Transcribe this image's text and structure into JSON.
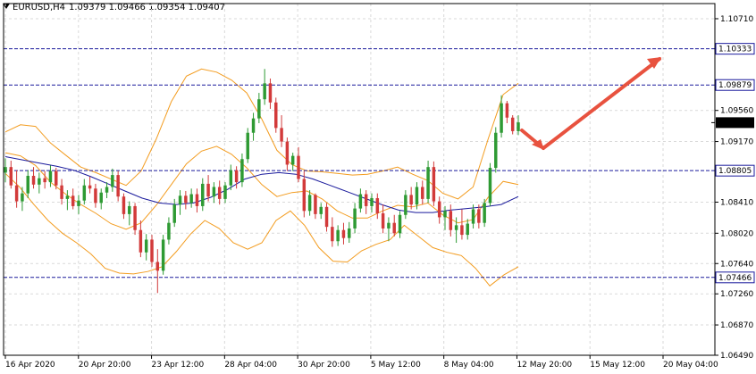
{
  "header": {
    "symbol": "EURUSD,H4",
    "open": "1.09379",
    "high": "1.09466",
    "low": "1.09354",
    "close": "1.09407"
  },
  "colors": {
    "background": "#ffffff",
    "grid": "#d9d9d9",
    "bull_candle": "#2e9a33",
    "bear_candle": "#d23a3a",
    "bollinger": "#f39c1f",
    "moving_average": "#1a1a9c",
    "level_line": "#1a1a9c",
    "arrow": "#e8523f"
  },
  "chart_data": {
    "type": "candlestick",
    "y_ticks": [
      "1.10710",
      "1.09560",
      "1.09170",
      "1.08410",
      "1.08020",
      "1.07640",
      "1.07260",
      "1.06870",
      "1.06490"
    ],
    "x_labels": [
      "16 Apr 2020",
      "20 Apr 20:00",
      "23 Apr 12:00",
      "28 Apr 04:00",
      "30 Apr 20:00",
      "5 May 12:00",
      "8 May 04:00",
      "12 May 20:00",
      "15 May 12:00",
      "20 May 04:00"
    ],
    "ylim": [
      1.0649,
      1.109
    ],
    "grid": true,
    "current_price": "1.09407",
    "horizontal_levels": [
      "1.10333",
      "1.09879",
      "1.08805",
      "1.07466"
    ],
    "candles_ohlc": [
      [
        1.0878,
        1.0896,
        1.0866,
        1.0885
      ],
      [
        1.0885,
        1.0893,
        1.0858,
        1.0862
      ],
      [
        1.0862,
        1.0881,
        1.0834,
        1.0842
      ],
      [
        1.0842,
        1.086,
        1.083,
        1.0852
      ],
      [
        1.0852,
        1.0881,
        1.0846,
        1.0874
      ],
      [
        1.0874,
        1.0885,
        1.0858,
        1.0863
      ],
      [
        1.0863,
        1.0878,
        1.0852,
        1.0871
      ],
      [
        1.0871,
        1.088,
        1.0858,
        1.0866
      ],
      [
        1.0866,
        1.0887,
        1.086,
        1.088
      ],
      [
        1.088,
        1.0884,
        1.0857,
        1.0862
      ],
      [
        1.0862,
        1.087,
        1.0838,
        1.0845
      ],
      [
        1.0845,
        1.0856,
        1.0831,
        1.0849
      ],
      [
        1.0849,
        1.0858,
        1.0832,
        1.0836
      ],
      [
        1.0836,
        1.085,
        1.0826,
        1.0843
      ],
      [
        1.0843,
        1.087,
        1.0838,
        1.0862
      ],
      [
        1.0862,
        1.0873,
        1.0852,
        1.0858
      ],
      [
        1.0858,
        1.0864,
        1.0834,
        1.084
      ],
      [
        1.084,
        1.0858,
        1.0832,
        1.0853
      ],
      [
        1.0853,
        1.0866,
        1.0846,
        1.086
      ],
      [
        1.086,
        1.0883,
        1.0854,
        1.0875
      ],
      [
        1.0875,
        1.088,
        1.0842,
        1.0848
      ],
      [
        1.0848,
        1.0852,
        1.082,
        1.0826
      ],
      [
        1.0826,
        1.0842,
        1.0812,
        1.0836
      ],
      [
        1.0836,
        1.084,
        1.08,
        1.0806
      ],
      [
        1.0806,
        1.0818,
        1.0772,
        1.0778
      ],
      [
        1.0778,
        1.0801,
        1.0768,
        1.0794
      ],
      [
        1.0794,
        1.08,
        1.076,
        1.0766
      ],
      [
        1.0766,
        1.0782,
        1.0727,
        1.0755
      ],
      [
        1.0755,
        1.08,
        1.075,
        1.0794
      ],
      [
        1.0794,
        1.0822,
        1.0788,
        1.0815
      ],
      [
        1.0815,
        1.0845,
        1.081,
        1.0838
      ],
      [
        1.0838,
        1.0856,
        1.0825,
        1.0849
      ],
      [
        1.0849,
        1.0855,
        1.0832,
        1.084
      ],
      [
        1.084,
        1.0858,
        1.0834,
        1.0851
      ],
      [
        1.0851,
        1.0858,
        1.0828,
        1.0836
      ],
      [
        1.0836,
        1.0871,
        1.083,
        1.0864
      ],
      [
        1.0864,
        1.0875,
        1.0842,
        1.0848
      ],
      [
        1.0848,
        1.0866,
        1.084,
        1.086
      ],
      [
        1.086,
        1.0868,
        1.0838,
        1.0845
      ],
      [
        1.0845,
        1.0866,
        1.084,
        1.0862
      ],
      [
        1.0862,
        1.0888,
        1.0856,
        1.0881
      ],
      [
        1.0881,
        1.0886,
        1.0858,
        1.0866
      ],
      [
        1.0866,
        1.0902,
        1.086,
        1.0895
      ],
      [
        1.0895,
        1.0934,
        1.089,
        1.0928
      ],
      [
        1.0928,
        1.0953,
        1.0918,
        1.0946
      ],
      [
        1.0946,
        1.0978,
        1.094,
        1.097
      ],
      [
        1.097,
        1.1008,
        1.0963,
        1.099
      ],
      [
        1.099,
        1.0996,
        1.0958,
        1.0966
      ],
      [
        1.0966,
        1.0972,
        1.0928,
        1.0934
      ],
      [
        1.0934,
        1.095,
        1.091,
        1.0917
      ],
      [
        1.0917,
        1.0922,
        1.088,
        1.0888
      ],
      [
        1.0888,
        1.0903,
        1.088,
        1.0899
      ],
      [
        1.0899,
        1.091,
        1.0866,
        1.087
      ],
      [
        1.087,
        1.088,
        1.0822,
        1.083
      ],
      [
        1.083,
        1.0856,
        1.0824,
        1.085
      ],
      [
        1.085,
        1.0852,
        1.082,
        1.0826
      ],
      [
        1.0826,
        1.084,
        1.082,
        1.0835
      ],
      [
        1.0835,
        1.084,
        1.0804,
        1.081
      ],
      [
        1.081,
        1.0822,
        1.0785,
        1.0792
      ],
      [
        1.0792,
        1.0812,
        1.0786,
        1.0806
      ],
      [
        1.0806,
        1.0815,
        1.0788,
        1.0796
      ],
      [
        1.0796,
        1.0816,
        1.079,
        1.0808
      ],
      [
        1.0808,
        1.084,
        1.0802,
        1.0833
      ],
      [
        1.0833,
        1.0858,
        1.0828,
        1.0851
      ],
      [
        1.0851,
        1.0856,
        1.0826,
        1.0836
      ],
      [
        1.0836,
        1.0852,
        1.0828,
        1.0846
      ],
      [
        1.0846,
        1.0852,
        1.082,
        1.0827
      ],
      [
        1.0827,
        1.0838,
        1.0802,
        1.0808
      ],
      [
        1.0808,
        1.0822,
        1.0792,
        1.0815
      ],
      [
        1.0815,
        1.0825,
        1.0798,
        1.0802
      ],
      [
        1.0802,
        1.083,
        1.0796,
        1.0825
      ],
      [
        1.0825,
        1.0856,
        1.082,
        1.085
      ],
      [
        1.085,
        1.086,
        1.0832,
        1.0838
      ],
      [
        1.0838,
        1.0866,
        1.0832,
        1.086
      ],
      [
        1.086,
        1.0868,
        1.0838,
        1.0845
      ],
      [
        1.0845,
        1.0893,
        1.084,
        1.0885
      ],
      [
        1.0885,
        1.0892,
        1.0836,
        1.0842
      ],
      [
        1.0842,
        1.0848,
        1.0814,
        1.0822
      ],
      [
        1.0822,
        1.0836,
        1.0806,
        1.083
      ],
      [
        1.083,
        1.0838,
        1.0798,
        1.0806
      ],
      [
        1.0806,
        1.0822,
        1.079,
        1.0812
      ],
      [
        1.0812,
        1.0832,
        1.0794,
        1.08
      ],
      [
        1.08,
        1.082,
        1.0794,
        1.0814
      ],
      [
        1.0814,
        1.0838,
        1.0808,
        1.0832
      ],
      [
        1.0832,
        1.0838,
        1.0808,
        1.0815
      ],
      [
        1.0815,
        1.0845,
        1.081,
        1.084
      ],
      [
        1.084,
        1.089,
        1.0836,
        1.0884
      ],
      [
        1.0884,
        1.0935,
        1.0878,
        1.0928
      ],
      [
        1.0928,
        1.0975,
        1.0922,
        1.0965
      ],
      [
        1.0965,
        1.0968,
        1.094,
        1.0947
      ],
      [
        1.0947,
        1.095,
        1.0926,
        1.093
      ],
      [
        1.093,
        1.095,
        1.0925,
        1.0941
      ]
    ],
    "moving_average": [
      1.0898,
      1.0894,
      1.089,
      1.0886,
      1.0881,
      1.0873,
      1.0864,
      1.0855,
      1.0846,
      1.084,
      1.0838,
      1.084,
      1.0847,
      1.0857,
      1.087,
      1.0876,
      1.0878,
      1.0876,
      1.087,
      1.0862,
      1.0854,
      1.0846,
      1.0838,
      1.0831,
      1.0828,
      1.0828,
      1.0831,
      1.0833,
      1.0835,
      1.0838,
      1.0848
    ],
    "bollinger_upper": [
      1.0929,
      1.0938,
      1.0936,
      1.0915,
      1.09,
      1.0885,
      1.0878,
      1.087,
      1.0862,
      1.088,
      1.092,
      1.0967,
      1.0999,
      1.1008,
      1.1004,
      1.0994,
      1.0978,
      1.0945,
      1.0906,
      1.0888,
      1.088,
      1.0879,
      1.0877,
      1.0875,
      1.0876,
      1.088,
      1.0885,
      1.0876,
      1.0868,
      1.0852,
      1.0845,
      1.086,
      1.092,
      1.0976,
      1.099
    ],
    "bollinger_lower": [
      1.0877,
      1.086,
      1.0838,
      1.0818,
      1.0802,
      1.079,
      1.0776,
      1.0758,
      1.0752,
      1.0751,
      1.0754,
      1.076,
      1.0779,
      1.0801,
      1.0818,
      1.0808,
      1.079,
      1.0782,
      1.079,
      1.0818,
      1.083,
      1.0812,
      1.0784,
      1.0767,
      1.0766,
      1.078,
      1.0788,
      1.0794,
      1.0812,
      1.0798,
      1.0784,
      1.0778,
      1.0774,
      1.0758,
      1.0736,
      1.075,
      1.076
    ],
    "bollinger_mid": [
      1.0903,
      1.0899,
      1.0887,
      1.0866,
      1.0851,
      1.0838,
      1.0827,
      1.0814,
      1.0807,
      1.0815,
      1.0837,
      1.0863,
      1.0889,
      1.0905,
      1.0911,
      1.0901,
      1.0884,
      1.0863,
      1.0848,
      1.0853,
      1.0855,
      1.0845,
      1.083,
      1.0821,
      1.0821,
      1.083,
      1.0837,
      1.0835,
      1.084,
      1.0825,
      1.0815,
      1.0819,
      1.0847,
      1.0867,
      1.0863
    ]
  }
}
